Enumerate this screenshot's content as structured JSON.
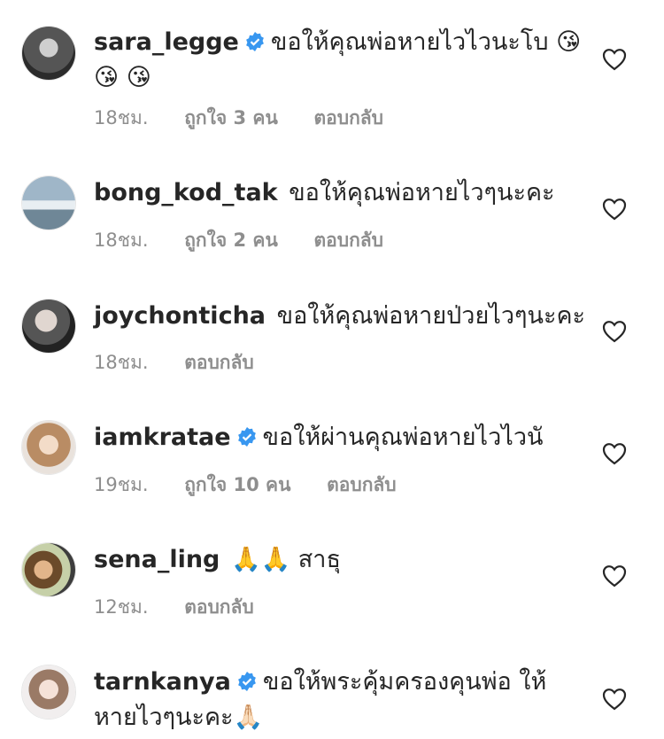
{
  "comments": [
    {
      "username": "sara_legge",
      "verified": true,
      "text": "ขอให้คุณพ่อหายไวไวนะโบ 😘",
      "text2": "😘 😘",
      "time": "18ชม.",
      "likes": "ถูกใจ 3 คน",
      "reply": "ตอบกลับ",
      "avatar_color": "#6b6b6b",
      "icons": [
        "verified-badge-icon",
        "heart-icon"
      ]
    },
    {
      "username": "bong_kod_tak",
      "verified": false,
      "text": "ขอให้คุณพ่อหายไวๆนะคะ",
      "time": "18ชม.",
      "likes": "ถูกใจ 2 คน",
      "reply": "ตอบกลับ",
      "avatar_color": "#7a93a8",
      "icons": [
        "heart-icon"
      ]
    },
    {
      "username": "joychonticha",
      "verified": false,
      "text": "ขอให้คุณพ่อหายป่วยไวๆนะคะ",
      "time": "18ชม.",
      "likes": "",
      "reply": "ตอบกลับ",
      "avatar_color": "#4a4a4a",
      "icons": [
        "heart-icon"
      ]
    },
    {
      "username": "iamkratae",
      "verified": true,
      "text": "ขอให้ผ่านคุณพ่อหายไวไวนั",
      "time": "19ชม.",
      "likes": "ถูกใจ 10 คน",
      "reply": "ตอบกลับ",
      "avatar_color": "#c9a27e",
      "icons": [
        "verified-badge-icon",
        "heart-icon"
      ]
    },
    {
      "username": "sena_ling",
      "verified": false,
      "text": "🙏🙏 สาธุ",
      "time": "12ชม.",
      "likes": "",
      "reply": "ตอบกลับ",
      "avatar_color": "#8a6a3e",
      "icons": [
        "heart-icon"
      ]
    },
    {
      "username": "tarnkanya",
      "verified": true,
      "text": "ขอให้พระคุ้มครองคุนพ่อ ให้",
      "text2": "หายไวๆนะคะ🙏🏻",
      "time": "",
      "likes": "",
      "reply": "",
      "avatar_color": "#d9c9c0",
      "icons": [
        "verified-badge-icon",
        "heart-icon"
      ]
    }
  ],
  "colors": {
    "verified": "#3897f0",
    "text": "#262626",
    "meta": "#8e8e8e"
  }
}
